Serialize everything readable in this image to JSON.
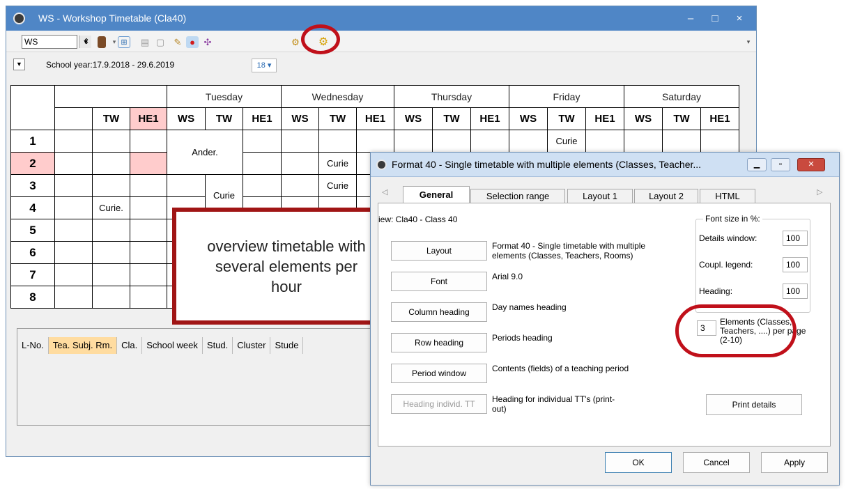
{
  "main_window": {
    "title": "WS - Workshop  Timetable  (Cla40)",
    "controls": {
      "minimize": "–",
      "maximize": "□",
      "close": "×"
    },
    "toolbar": {
      "element_combo": "WS",
      "icons": [
        "spinner-icon",
        "book-icon",
        "grid-icon",
        "export-icon",
        "lock-icon",
        "palette-icon",
        "pin-icon",
        "network-icon",
        "settings-gear-icon",
        "format-gear-icon"
      ]
    },
    "school_year": "School year:17.9.2018 - 29.6.2019",
    "calendar_button": "18 ▾"
  },
  "timetable": {
    "days": [
      "Tuesday",
      "Wednesday",
      "Thursday",
      "Friday",
      "Saturday"
    ],
    "first_day_columns": [
      "TW",
      "HE1"
    ],
    "day_columns": [
      "WS",
      "TW",
      "HE1"
    ],
    "periods": [
      "1",
      "2",
      "3",
      "4",
      "5",
      "6",
      "7",
      "8"
    ],
    "lessons": {
      "ander": "Ander.",
      "curie_wed_2": "Curie",
      "curie_wed_3": "Curie",
      "curie_tue_tw": "Curie",
      "curie_mon_4": "Curie.",
      "curie_fri_1": "Curie"
    },
    "highlight_color": "#ffcccc"
  },
  "details": {
    "columns": [
      "L-No.",
      "Tea. Subj. Rm.",
      "Cla.",
      "School week",
      "Stud.",
      "Cluster",
      "Stude"
    ]
  },
  "callout": {
    "text": "overview timetable with several elements per hour"
  },
  "dialog": {
    "title": "Format 40 - Single timetable with multiple elements (Classes, Teacher...",
    "tabs": [
      "General",
      "Selection range",
      "Layout 1",
      "Layout 2",
      "HTML"
    ],
    "active_tab": "General",
    "view": "iew: Cla40 - Class 40",
    "buttons": [
      {
        "label": "Layout",
        "desc": "Format 40 - Single timetable with multiple elements (Classes, Teachers, Rooms)"
      },
      {
        "label": "Font",
        "desc": "Arial 9.0"
      },
      {
        "label": "Column heading",
        "desc": "Day names heading"
      },
      {
        "label": "Row heading",
        "desc": "Periods heading"
      },
      {
        "label": "Period window",
        "desc": "Contents (fields) of a teaching period"
      },
      {
        "label": "Heading individ. TT",
        "desc": "Heading for individual TT's (print-out)"
      }
    ],
    "font_size": {
      "legend": "Font size in %:",
      "details_window_label": "Details window:",
      "details_window": "100",
      "coupl_legend_label": "Coupl. legend:",
      "coupl_legend": "100",
      "heading_label": "Heading:",
      "heading": "100"
    },
    "elements": {
      "value": "3",
      "label": "Elements (Classes, Teachers, ....) per page (2-10)"
    },
    "print_details": "Print details",
    "ok": "OK",
    "cancel": "Cancel",
    "apply": "Apply"
  },
  "colors": {
    "accent_red": "#c0101a",
    "title_blue": "#4f86c6",
    "selected_header": "#ffdca0"
  }
}
